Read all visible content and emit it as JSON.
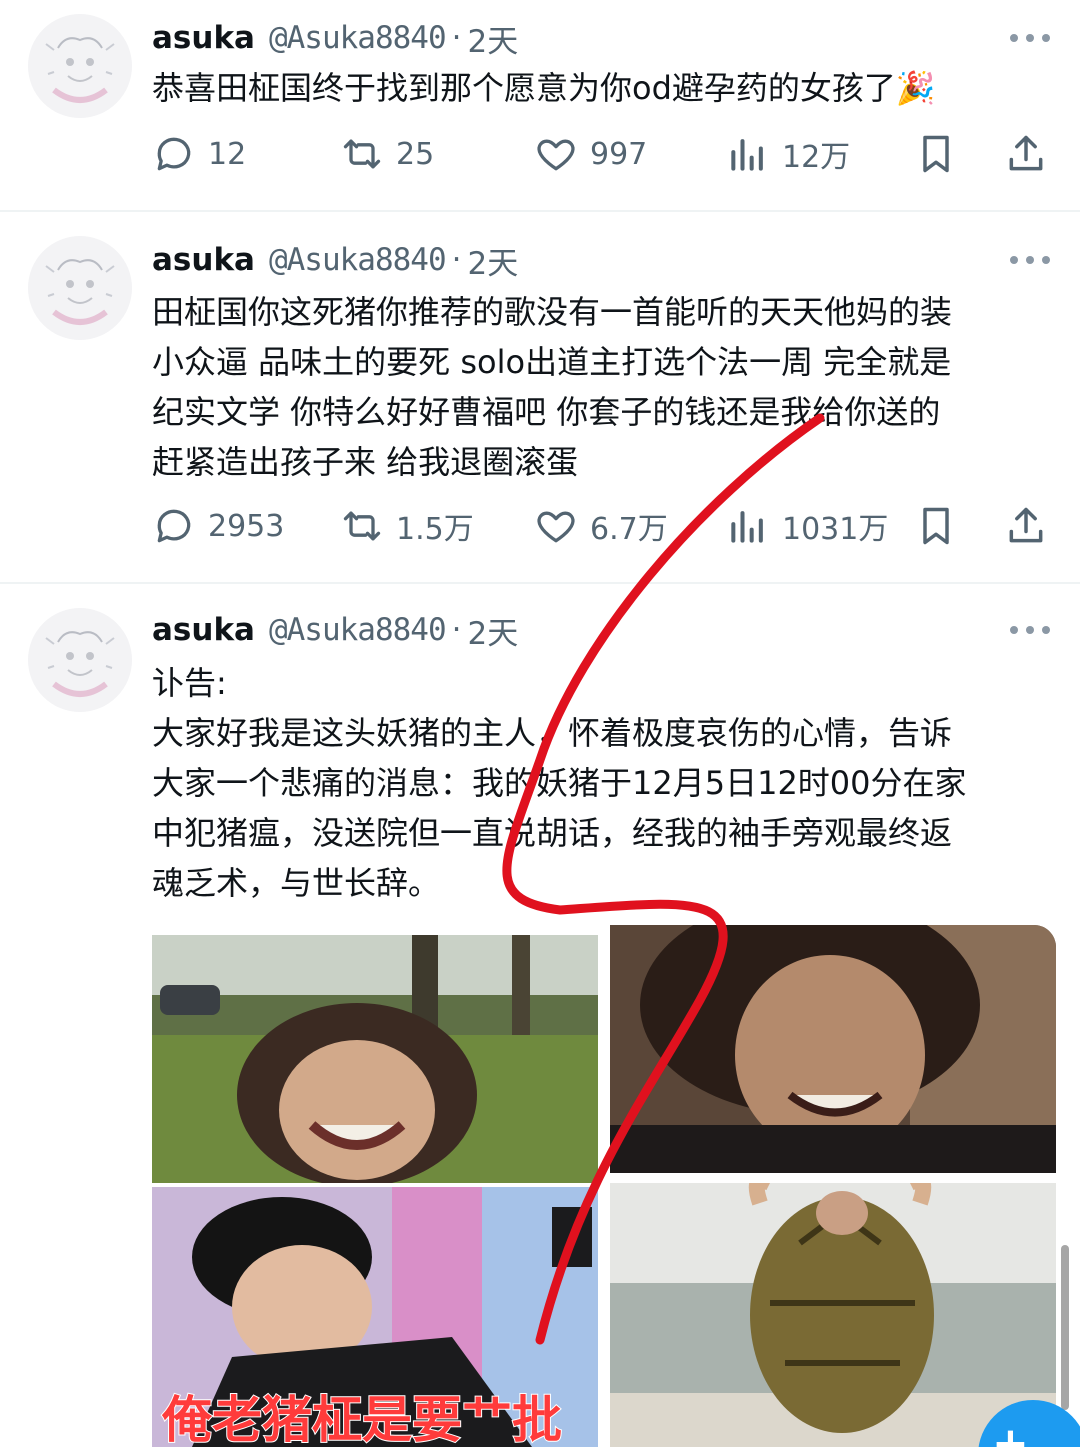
{
  "tweets": [
    {
      "name": "asuka",
      "handle": "@Asuka8840",
      "sep": "·",
      "time": "2天",
      "lines": [
        "恭喜田柾国终于找到那个愿意为你od避孕药的女孩了🎉"
      ],
      "replies": "12",
      "retweets": "25",
      "likes": "997",
      "views": "12万"
    },
    {
      "name": "asuka",
      "handle": "@Asuka8840",
      "sep": "·",
      "time": "2天",
      "lines": [
        "田柾国你这死猪你推荐的歌没有一首能听的天天他妈的装",
        "小众逼 品味土的要死 solo出道主打选个法一周 完全就是",
        "纪实文学 你特么好好曹福吧 你套子的钱还是我给你送的",
        "赶紧造出孩子来 给我退圈滚蛋"
      ],
      "replies": "2953",
      "retweets": "1.5万",
      "likes": "6.7万",
      "views": "1031万"
    },
    {
      "name": "asuka",
      "handle": "@Asuka8840",
      "sep": "·",
      "time": "2天",
      "lines": [
        "讣告:",
        "大家好我是这头妖猪的主人，怀着极度哀伤的心情，告诉",
        "大家一个悲痛的消息：我的妖猪于12月5日12时00分在家",
        "中犯猪瘟，没送院但一直说胡话，经我的袖手旁观最终返",
        "魂乏术，与世长辞。"
      ],
      "image_caption": "俺老猪柾是要艹批"
    }
  ],
  "icons": {
    "reply": "reply-icon",
    "retweet": "retweet-icon",
    "like": "heart-icon",
    "views": "views-icon",
    "bookmark": "bookmark-icon",
    "share": "share-icon",
    "more": "more-icon"
  },
  "colors": {
    "text": "#0f1419",
    "secondary": "#536471",
    "accent": "#1d9bf0",
    "annotation": "#e0111e"
  }
}
